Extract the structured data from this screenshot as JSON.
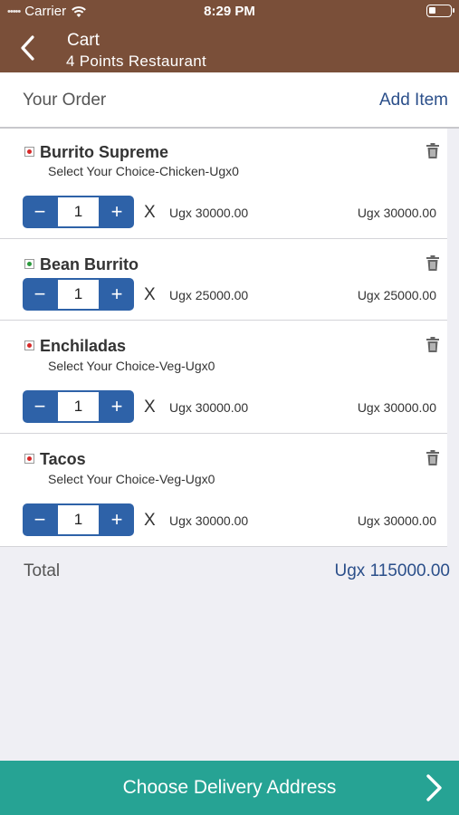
{
  "status_bar": {
    "carrier": "Carrier",
    "time": "8:29 PM"
  },
  "nav": {
    "title": "Cart",
    "subtitle": "4 Points Restaurant"
  },
  "order_header": {
    "label": "Your Order",
    "add_item": "Add Item"
  },
  "items": [
    {
      "name": "Burrito Supreme",
      "choice": "Select Your Choice-Chicken-Ugx0",
      "qty": "1",
      "unit_price": "Ugx 30000.00",
      "line_total": "Ugx 30000.00",
      "veg_color": "#d62828"
    },
    {
      "name": "Bean Burrito",
      "choice": "",
      "qty": "1",
      "unit_price": "Ugx 25000.00",
      "line_total": "Ugx 25000.00",
      "veg_color": "#2a9a3c"
    },
    {
      "name": "Enchiladas",
      "choice": "Select Your Choice-Veg-Ugx0",
      "qty": "1",
      "unit_price": "Ugx 30000.00",
      "line_total": "Ugx 30000.00",
      "veg_color": "#d62828"
    },
    {
      "name": "Tacos",
      "choice": "Select Your Choice-Veg-Ugx0",
      "qty": "1",
      "unit_price": "Ugx 30000.00",
      "line_total": "Ugx 30000.00",
      "veg_color": "#d62828"
    }
  ],
  "stepper": {
    "minus": "−",
    "plus": "+",
    "times": "X"
  },
  "total": {
    "label": "Total",
    "amount": "Ugx 115000.00"
  },
  "footer": {
    "label": "Choose Delivery Address"
  },
  "colors": {
    "brand": "#7a4f39",
    "accent": "#2b4f8a",
    "stepper": "#2e62a8",
    "footer": "#26a394"
  },
  "icons": {
    "back": "chevron-left-icon",
    "delete": "trash-icon",
    "next": "chevron-right-icon",
    "wifi": "wifi-icon",
    "battery": "battery-icon"
  }
}
